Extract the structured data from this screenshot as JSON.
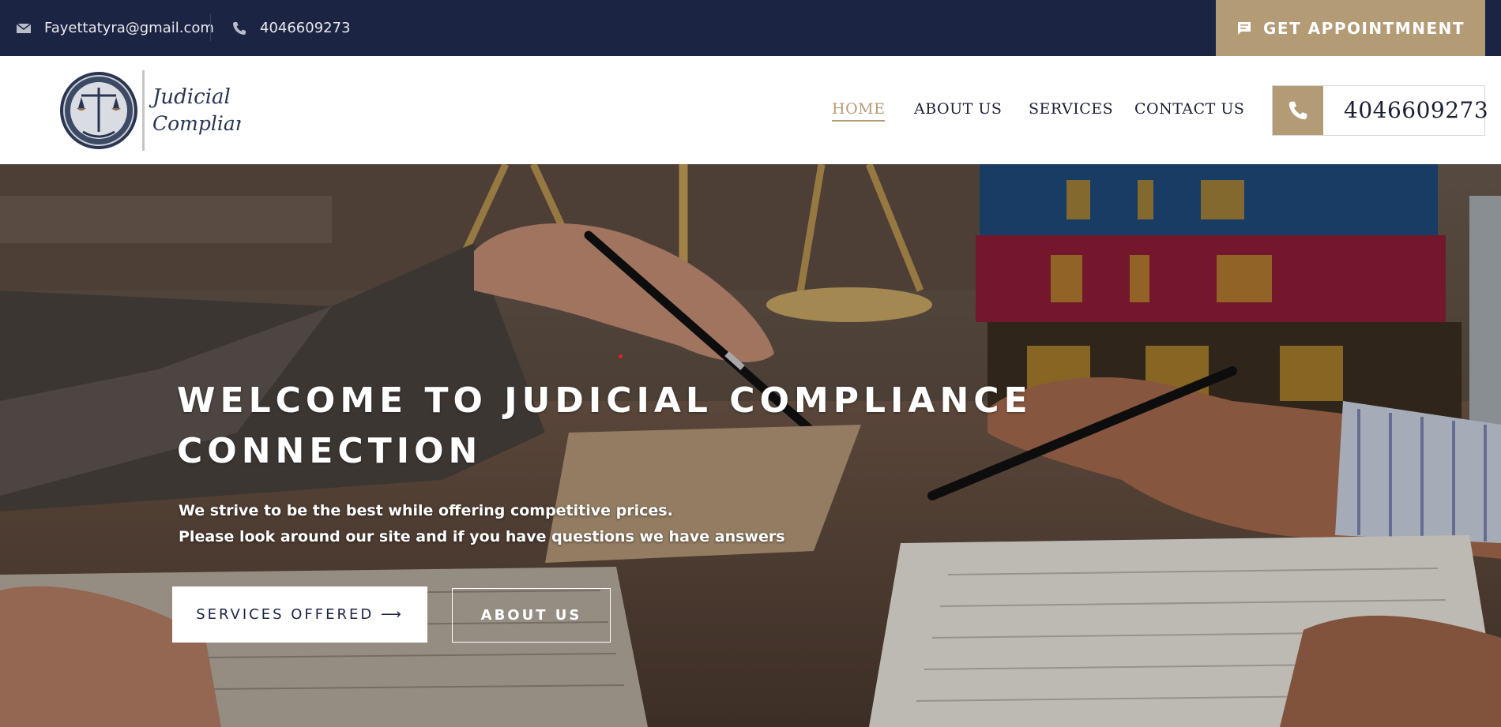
{
  "topbar": {
    "email": "Fayettatyra@gmail.com",
    "phone": "4046609273",
    "appointment_label": "GET APPOINTMNENT",
    "email_icon": "envelope-icon",
    "phone_icon": "phone-icon",
    "appointment_icon": "chat-icon"
  },
  "header": {
    "logo_line1": "Judicial",
    "logo_line2": "Compliance",
    "nav": [
      {
        "label": "HOME",
        "active": true
      },
      {
        "label": "ABOUT US",
        "active": false
      },
      {
        "label": "SERVICES",
        "active": false
      },
      {
        "label": "CONTACT US",
        "active": false
      }
    ],
    "phone": "4046609273"
  },
  "hero": {
    "title_line1": "WELCOME TO JUDICIAL COMPLIANCE",
    "title_line2": "CONNECTION",
    "subtitle_line1": "We strive to be the best while offering competitive prices.",
    "subtitle_line2": "Please look around our site and if you have questions we have answers",
    "services_button": "SERVICES OFFERED ⟶",
    "about_button": "ABOUT US"
  },
  "colors": {
    "navy": "#1c2444",
    "accent": "#b39b76",
    "white": "#ffffff"
  }
}
